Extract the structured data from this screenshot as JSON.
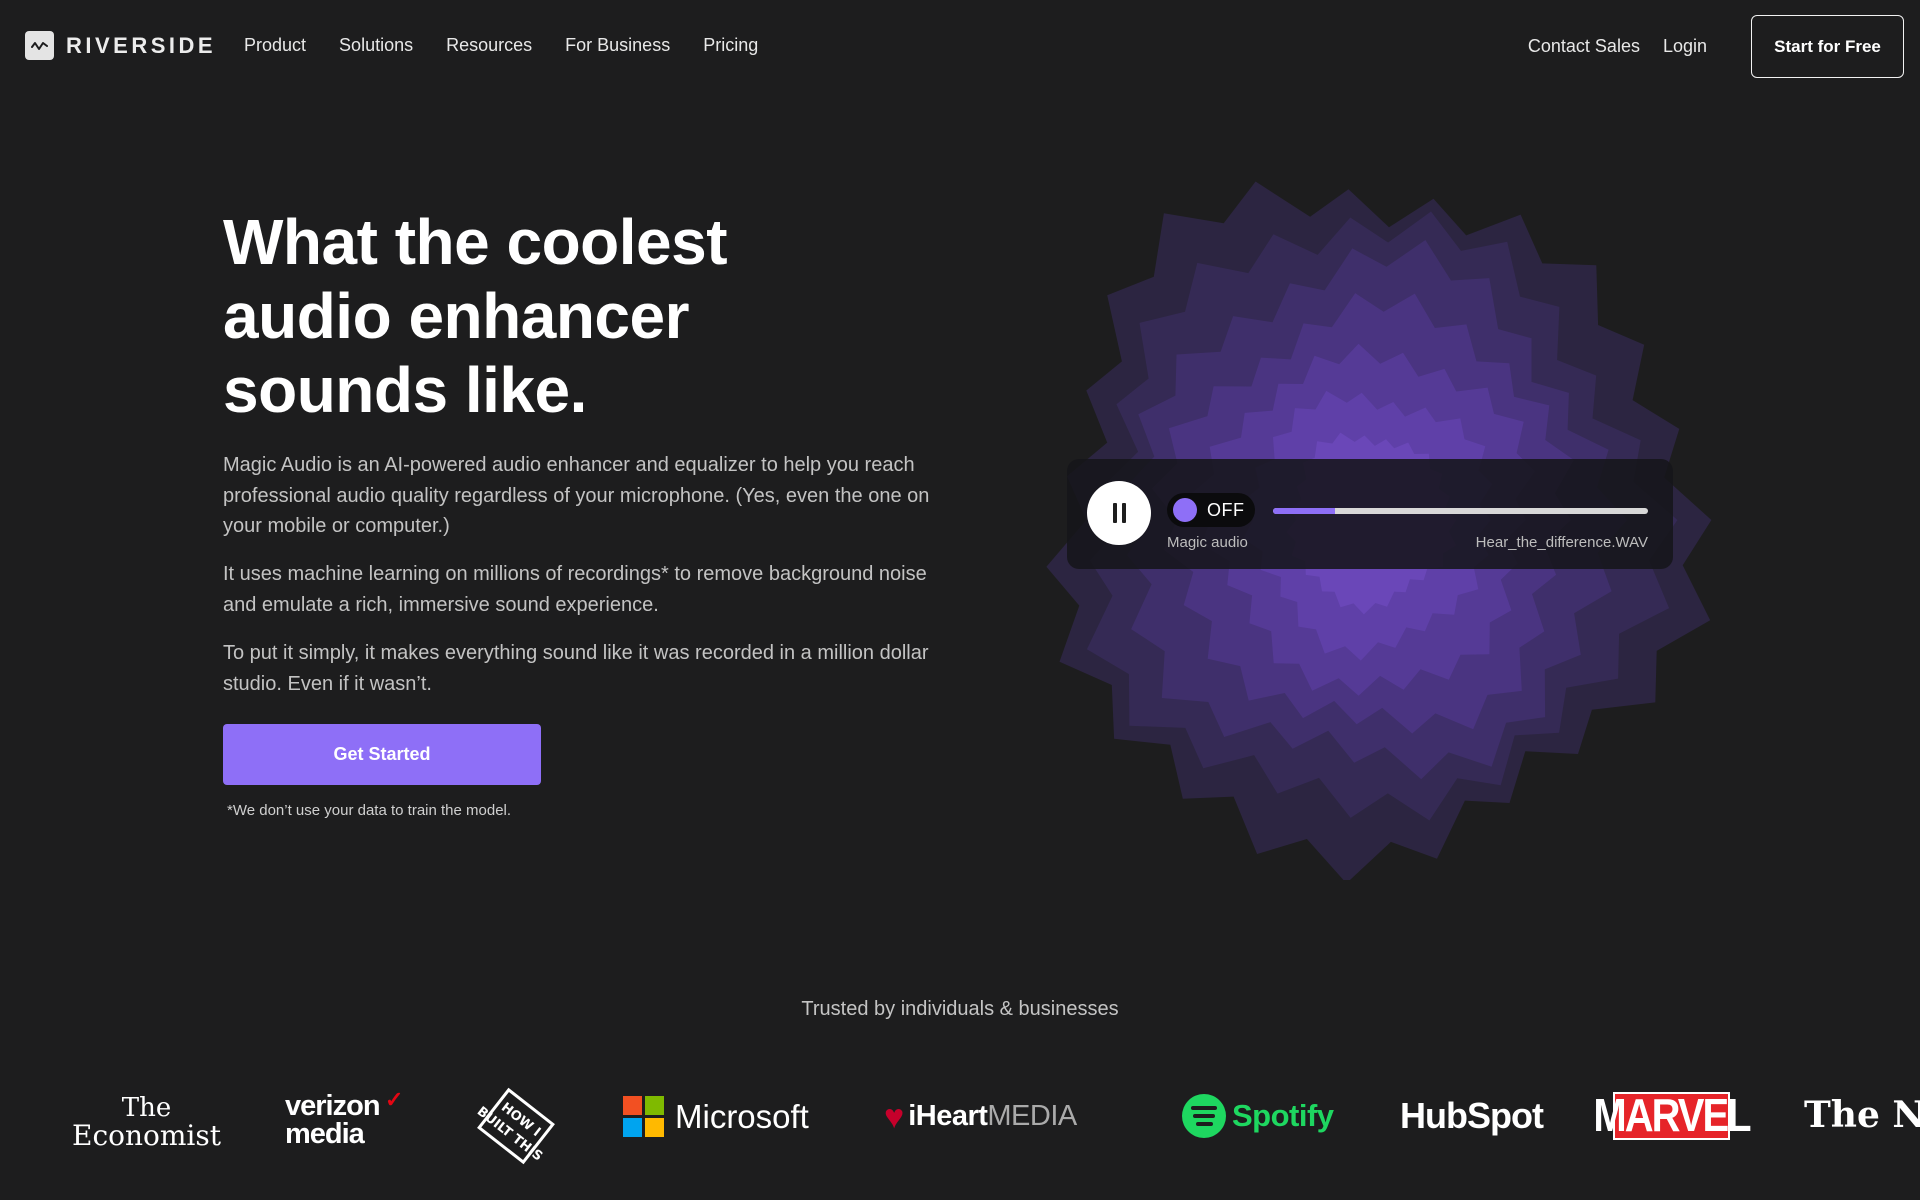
{
  "nav": {
    "brand": "RIVERSIDE",
    "links": [
      "Product",
      "Solutions",
      "Resources",
      "For Business",
      "Pricing"
    ],
    "contact_sales": "Contact Sales",
    "login": "Login",
    "cta": "Start for Free"
  },
  "hero": {
    "title_line1": "What the coolest",
    "title_line2": "audio enhancer",
    "title_line3": "sounds like.",
    "paragraph1": "Magic Audio is an AI-powered audio enhancer and equalizer to help you reach professional audio quality regardless of your microphone. (Yes, even the one on your mobile or computer.)",
    "paragraph2": "It uses machine learning on millions of recordings* to remove background noise and emulate a rich, immersive sound experience.",
    "paragraph3": "To put it simply, it makes everything sound like it was recorded in a million dollar studio. Even if it wasn’t.",
    "cta": "Get Started",
    "disclaimer": "*We don’t use your data to train the model."
  },
  "player": {
    "toggle_state": "OFF",
    "toggle_label": "Magic audio",
    "file_name": "Hear_the_difference.WAV",
    "progress": 0.165,
    "state": "playing",
    "accent": "#8e6ff7"
  },
  "trusted": {
    "heading": "Trusted by individuals & businesses",
    "economist_line1": "The",
    "economist_line2": "Economist",
    "verizon_line1": "verizon",
    "verizon_line2": "media",
    "howbuilt_text": "HOW I BUILT THIS",
    "microsoft": "Microsoft",
    "iheart_bold": "iHeart",
    "iheart_light": "MEDIA",
    "spotify": "Spotify",
    "hubspot": "HubSpot",
    "marvel": "MARVEL",
    "nyt": "The New"
  }
}
